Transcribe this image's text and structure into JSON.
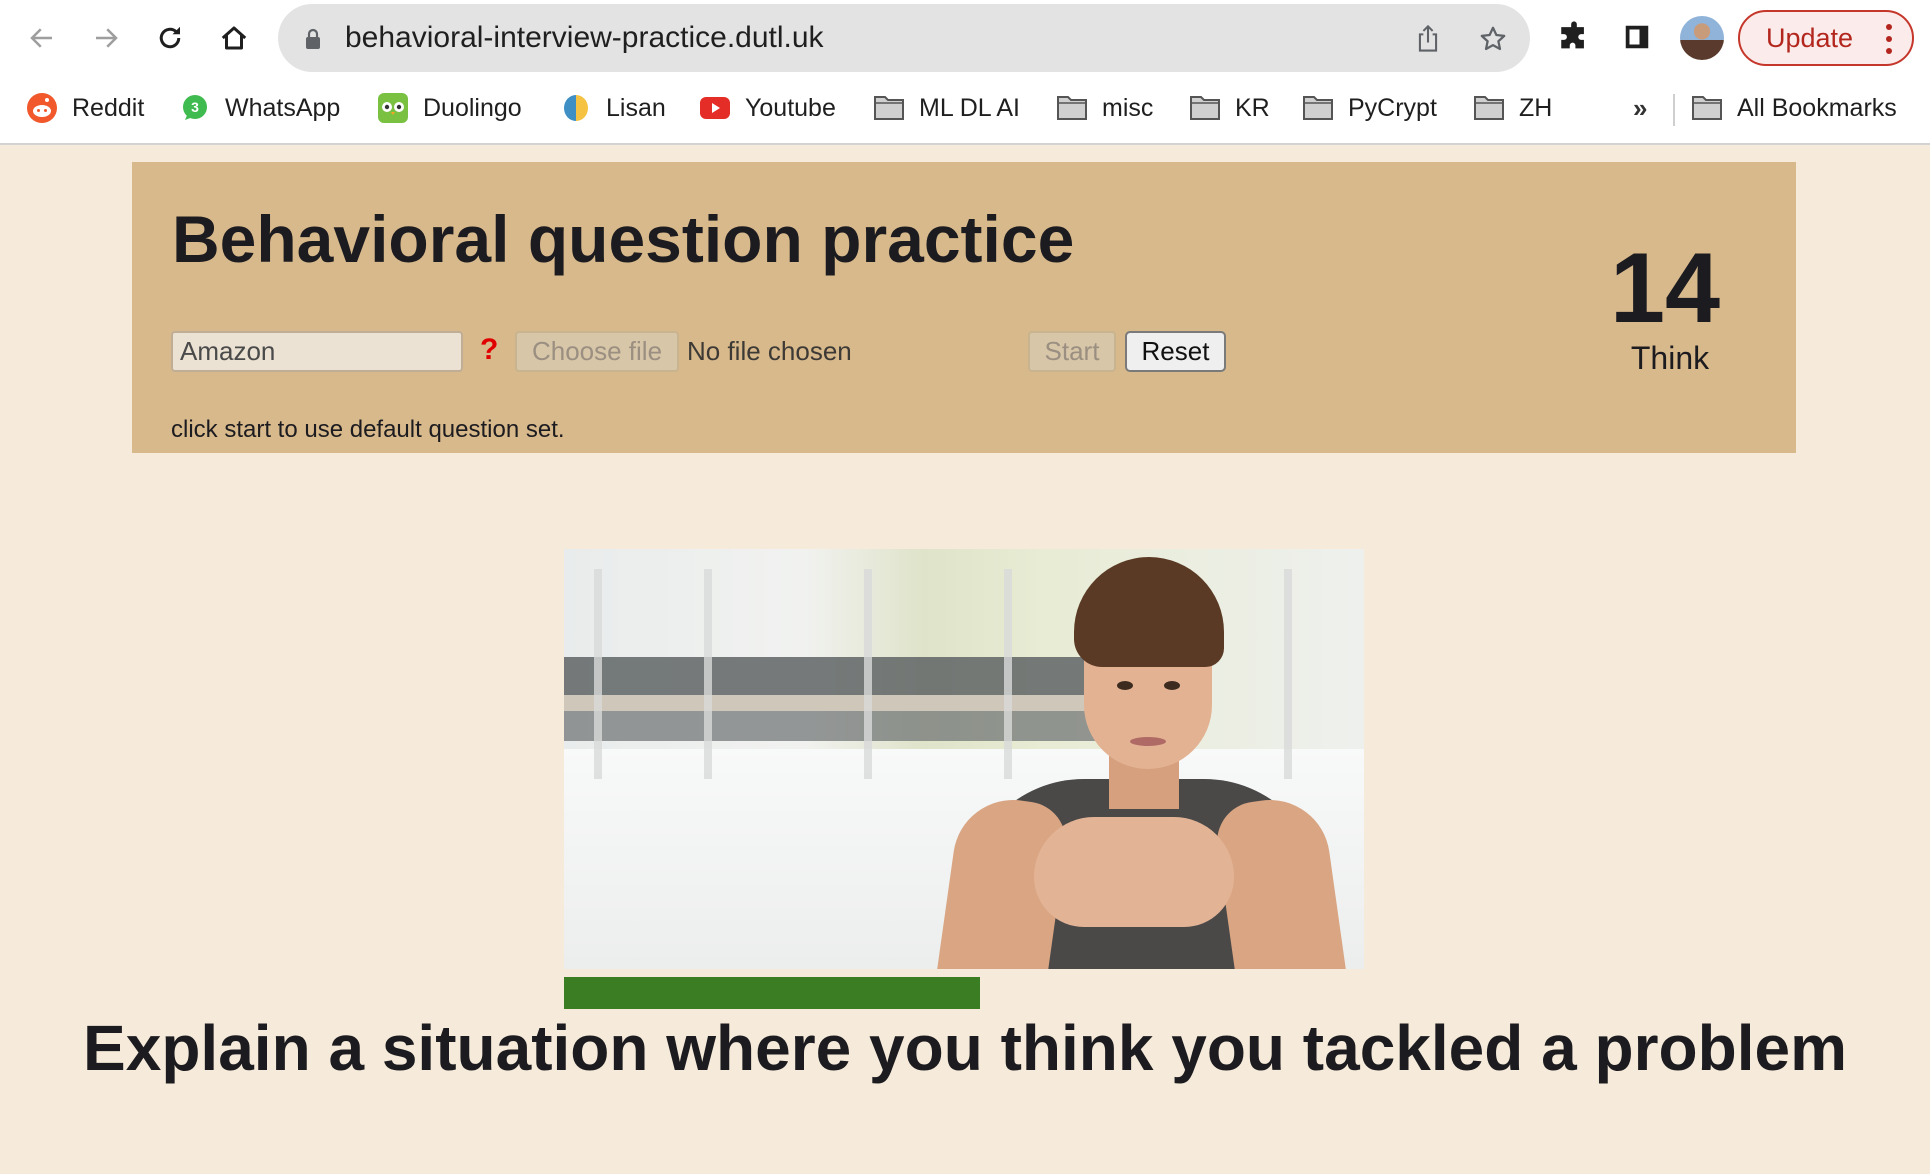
{
  "browser": {
    "url": "behavioral-interview-practice.dutl.uk",
    "update_label": "Update",
    "nav_icons": [
      "back-arrow-icon",
      "forward-arrow-icon",
      "reload-icon",
      "home-icon"
    ],
    "omnibox_icons": [
      "lock-icon",
      "share-icon",
      "star-icon"
    ],
    "toolbar_icons": [
      "extensions-puzzle-icon",
      "side-panel-icon",
      "profile-avatar",
      "kebab-menu-icon"
    ],
    "bookmarks": [
      {
        "label": "Reddit",
        "icon": "reddit-icon"
      },
      {
        "label": "WhatsApp",
        "icon": "whatsapp-icon",
        "badge": "3"
      },
      {
        "label": "Duolingo",
        "icon": "duolingo-icon"
      },
      {
        "label": "Lisan",
        "icon": "lisan-icon"
      },
      {
        "label": "Youtube",
        "icon": "youtube-icon"
      },
      {
        "label": "ML DL AI",
        "icon": "folder-icon"
      },
      {
        "label": "misc",
        "icon": "folder-icon"
      },
      {
        "label": "KR",
        "icon": "folder-icon"
      },
      {
        "label": "PyCrypt",
        "icon": "folder-icon"
      },
      {
        "label": "ZH",
        "icon": "folder-icon"
      }
    ],
    "more_bookmarks": "»",
    "all_bookmarks": "All Bookmarks"
  },
  "page": {
    "title": "Behavioral question practice",
    "company_input": {
      "value": "Amazon",
      "placeholder": ""
    },
    "help_glyph": "?",
    "choose_file_label": "Choose file",
    "file_status": "No file chosen",
    "start_label": "Start",
    "reset_label": "Reset",
    "hint": "click start to use default question set.",
    "timer": {
      "value": "14",
      "phase": "Think"
    },
    "progress": {
      "fraction": 0.52,
      "color": "#3a7d23"
    },
    "question": "Explain a situation where you think you tackled a problem"
  },
  "colors": {
    "page_bg": "#f6ebda",
    "panel_bg": "#d8b98c",
    "update_accent": "#b3261e"
  }
}
